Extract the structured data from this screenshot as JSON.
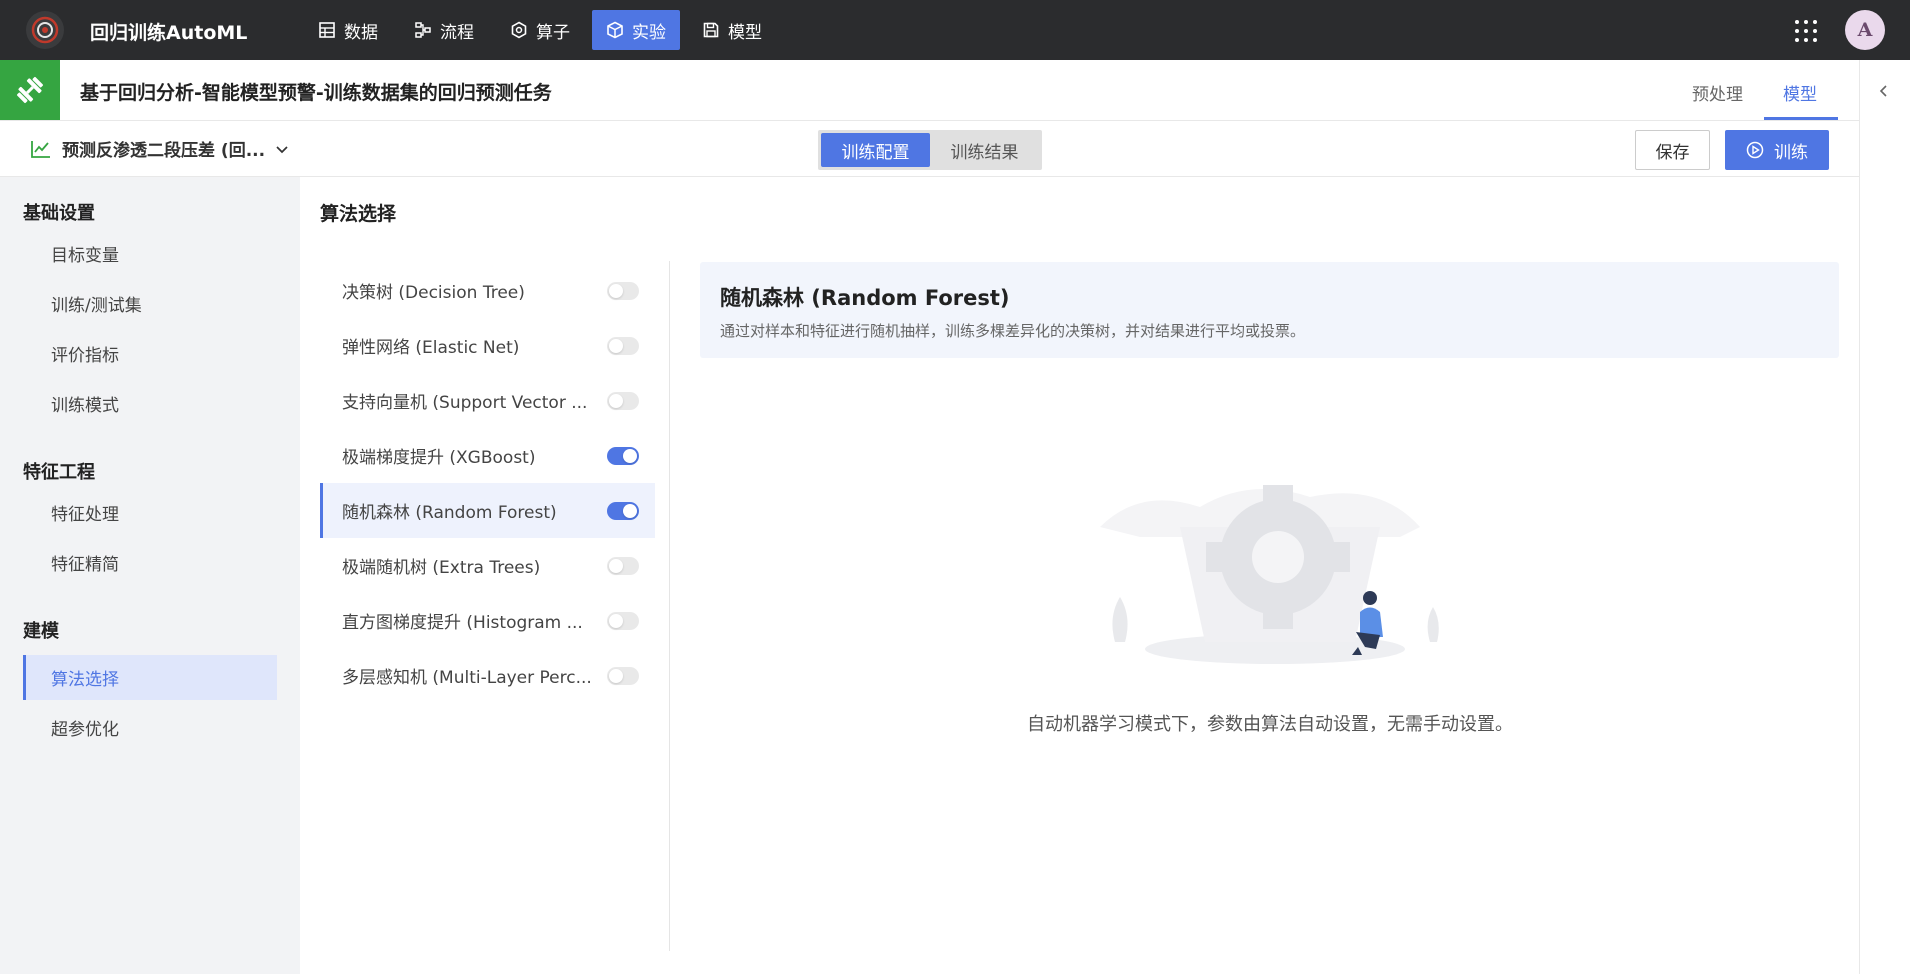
{
  "app": {
    "title": "回归训练AutoML",
    "avatar_letter": "A"
  },
  "nav": [
    {
      "label": "数据",
      "icon": "grid-icon",
      "active": false
    },
    {
      "label": "流程",
      "icon": "flow-icon",
      "active": false
    },
    {
      "label": "算子",
      "icon": "hexagon-icon",
      "active": false
    },
    {
      "label": "实验",
      "icon": "cube-icon",
      "active": true
    },
    {
      "label": "模型",
      "icon": "save-icon",
      "active": false
    }
  ],
  "project": {
    "title": "基于回归分析-智能模型预警-训练数据集的回归预测任务",
    "tabs": {
      "preprocess": "预处理",
      "model": "模型"
    }
  },
  "toolbar": {
    "task_name": "预测反渗透二段压差 (回...",
    "seg_config": "训练配置",
    "seg_result": "训练结果",
    "save_label": "保存",
    "train_label": "训练"
  },
  "sidebar": {
    "groups": [
      {
        "title": "基础设置",
        "items": [
          "目标变量",
          "训练/测试集",
          "评价指标",
          "训练模式"
        ]
      },
      {
        "title": "特征工程",
        "items": [
          "特征处理",
          "特征精简"
        ]
      },
      {
        "title": "建模",
        "items": [
          "算法选择",
          "超参优化"
        ]
      }
    ],
    "active_item": "算法选择"
  },
  "main": {
    "section_title": "算法选择",
    "algorithms": [
      {
        "label": "决策树 (Decision Tree)",
        "enabled": false
      },
      {
        "label": "弹性网络 (Elastic Net)",
        "enabled": false
      },
      {
        "label": "支持向量机 (Support Vector ...",
        "enabled": false
      },
      {
        "label": "极端梯度提升 (XGBoost)",
        "enabled": true
      },
      {
        "label": "随机森林 (Random Forest)",
        "enabled": true
      },
      {
        "label": "极端随机树 (Extra Trees)",
        "enabled": false
      },
      {
        "label": "直方图梯度提升 (Histogram ...",
        "enabled": false
      },
      {
        "label": "多层感知机 (Multi-Layer Perc...",
        "enabled": false
      }
    ],
    "selected_index": 4,
    "detail": {
      "title": "随机森林 (Random Forest)",
      "description": "通过对样本和特征进行随机抽样，训练多棵差异化的决策树，并对结果进行平均或投票。"
    },
    "auto_note": "自动机器学习模式下，参数由算法自动设置，无需手动设置。"
  },
  "colors": {
    "accent": "#4f76e3",
    "topbar": "#2b2c2e",
    "project_icon_bg": "#35a541"
  }
}
